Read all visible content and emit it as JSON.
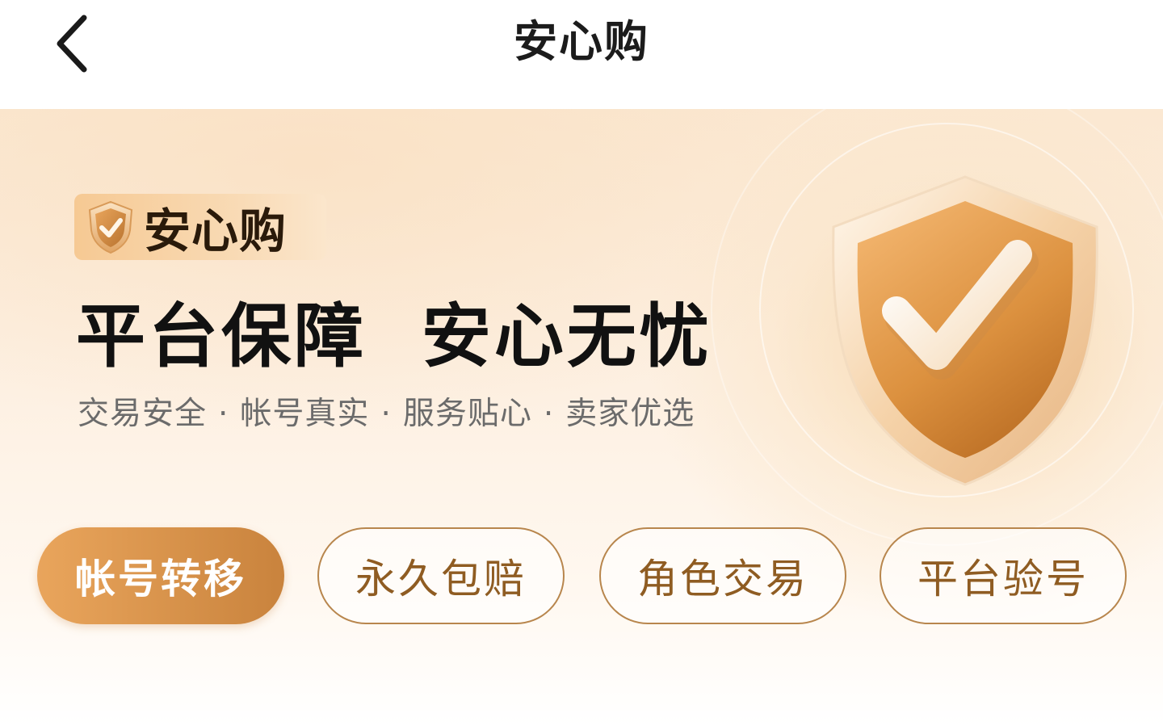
{
  "header": {
    "title": "安心购",
    "back_icon": "chevron-left-icon"
  },
  "banner": {
    "badge": {
      "icon": "shield-check-icon",
      "label": "安心购"
    },
    "headline": "平台保障  安心无忧",
    "features": [
      "交易安全",
      "帐号真实",
      "服务贴心",
      "卖家优选"
    ],
    "features_separator": "·",
    "illustration_icon": "shield-check-icon"
  },
  "tabs": [
    {
      "label": "帐号转移",
      "active": true
    },
    {
      "label": "永久包赔",
      "active": false
    },
    {
      "label": "角色交易",
      "active": false
    },
    {
      "label": "平台验号",
      "active": false
    }
  ],
  "colors": {
    "accent": "#d8934a",
    "accent_dark": "#c9833d",
    "outline": "#b8864d",
    "outline_text": "#8f5c22",
    "banner_bg": "#fbe8d2"
  }
}
